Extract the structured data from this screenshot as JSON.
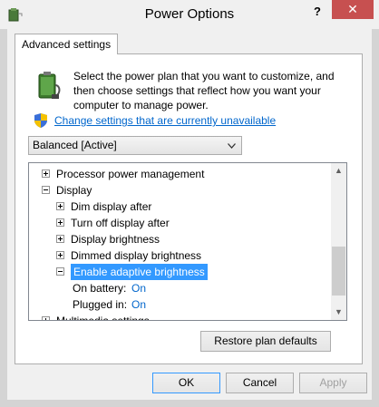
{
  "window": {
    "title": "Power Options",
    "help_label": "?",
    "close_label": "✕"
  },
  "tab": {
    "label": "Advanced settings"
  },
  "intro_text": "Select the power plan that you want to customize, and then choose settings that reflect how you want your computer to manage power.",
  "change_link": "Change settings that are currently unavailable",
  "plan_select": {
    "selected": "Balanced [Active]"
  },
  "tree": {
    "items": [
      {
        "label": "Processor power management",
        "expander": "plus"
      },
      {
        "label": "Display",
        "expander": "minus"
      },
      {
        "label": "Dim display after",
        "expander": "plus"
      },
      {
        "label": "Turn off display after",
        "expander": "plus"
      },
      {
        "label": "Display brightness",
        "expander": "plus"
      },
      {
        "label": "Dimmed display brightness",
        "expander": "plus"
      },
      {
        "label": "Enable adaptive brightness",
        "expander": "minus",
        "selected": true
      },
      {
        "label": "On battery:",
        "value": "On"
      },
      {
        "label": "Plugged in:",
        "value": "On"
      },
      {
        "label": "Multimedia settings",
        "expander": "plus"
      }
    ]
  },
  "buttons": {
    "restore": "Restore plan defaults",
    "ok": "OK",
    "cancel": "Cancel",
    "apply": "Apply"
  },
  "colors": {
    "accent": "#3399ff",
    "link": "#0066cc",
    "close": "#c75050"
  }
}
